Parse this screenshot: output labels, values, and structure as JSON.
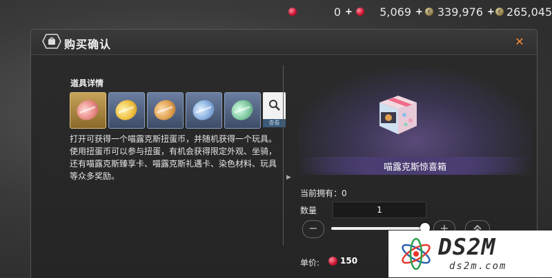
{
  "currencies": [
    {
      "icon": "red-gem-icon",
      "amount": "0"
    },
    {
      "icon": "red-gem-icon",
      "amount": "5,069"
    },
    {
      "icon": "coin-icon",
      "amount": "339,976"
    },
    {
      "icon": "coin-icon",
      "amount": "265,045"
    }
  ],
  "dialog": {
    "title": "购买确认"
  },
  "details": {
    "section_title": "道具详情",
    "view_label": "查看",
    "description": "打开可获得一个喵露克斯扭蛋币，并随机获得一个玩具。使用扭蛋币可以参与扭蛋，有机会获得限定外观、坐骑，还有喵露克斯臻享卡、喵露克斯礼遇卡、染色材料、玩具等众多奖励。"
  },
  "item": {
    "name": "喵露克斯惊喜箱",
    "owned_label": "当前拥有：0",
    "quantity_label": "数量",
    "quantity": "1",
    "price_label": "单价:",
    "price": "150"
  },
  "slider": {
    "fraction": 1.0
  },
  "watermark": {
    "brand": "DS2M",
    "url": "ds2m.com"
  },
  "colors": {
    "accent": "#ff8a3a",
    "name_bar": "#4b3d72",
    "gem": "#c8102e"
  }
}
